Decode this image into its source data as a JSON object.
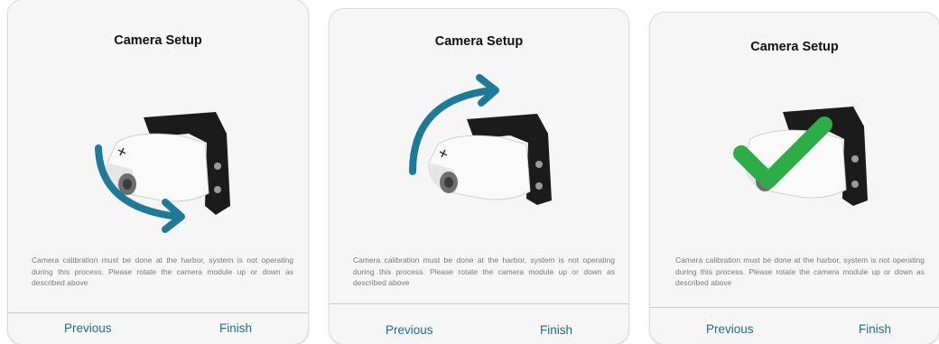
{
  "panels": [
    {
      "title": "Camera Setup",
      "description": "Camera calibration must be done at the harbor, system is not operating during this process. Please rotate the camera module up or down as described above",
      "previous_label": "Previous",
      "finish_label": "Finish",
      "indicator": "rotate-down-arrow-icon"
    },
    {
      "title": "Camera Setup",
      "description": "Camera calibration must be done at the harbor, system is not operating during this process. Please rotate the camera module up or down as described above",
      "previous_label": "Previous",
      "finish_label": "Finish",
      "indicator": "rotate-up-arrow-icon"
    },
    {
      "title": "Camera Setup",
      "description": "Camera calibration must be done at the harbor, system is not operating during this process. Please rotate the camera module up or down as described above",
      "previous_label": "Previous",
      "finish_label": "Finish",
      "indicator": "checkmark-icon"
    }
  ],
  "colors": {
    "arrow": "#1f7a99",
    "check": "#2eac48",
    "button_text": "#1f6f8b",
    "description_text": "#7a7a7a"
  }
}
